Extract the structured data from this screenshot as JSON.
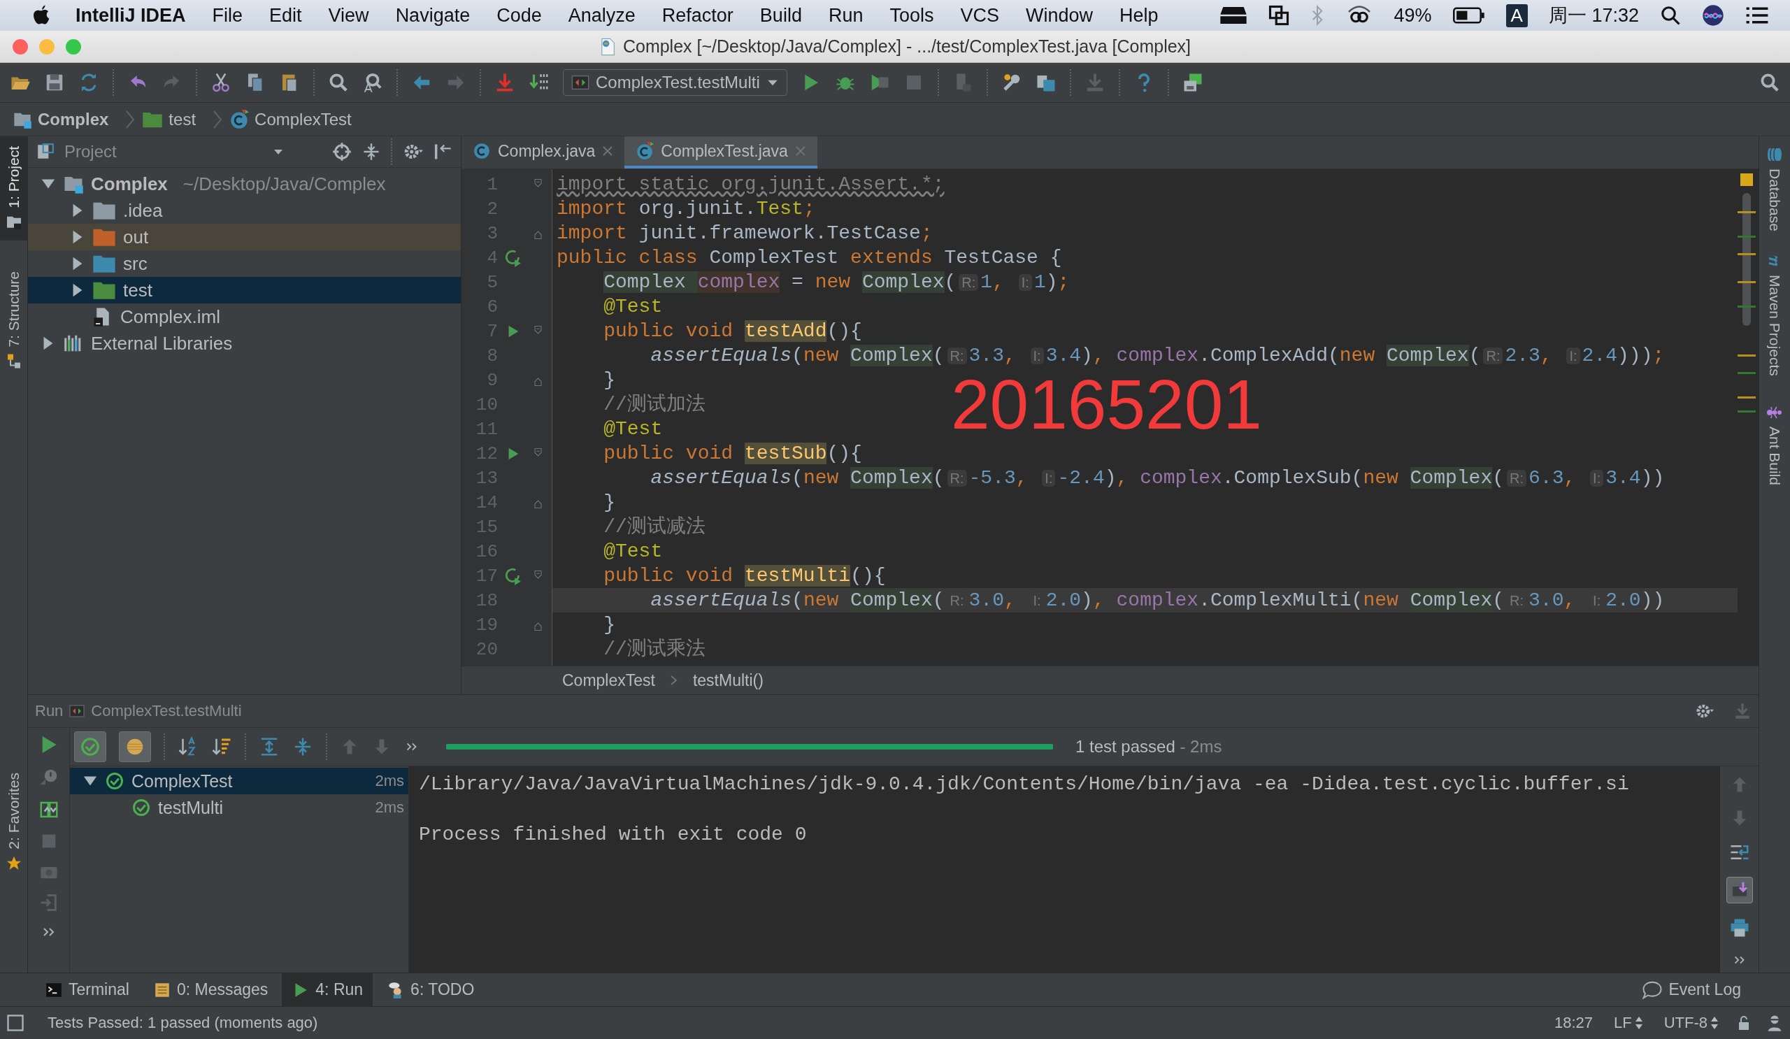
{
  "menubar": {
    "app": "IntelliJ IDEA",
    "items": [
      "File",
      "Edit",
      "View",
      "Navigate",
      "Code",
      "Analyze",
      "Refactor",
      "Build",
      "Run",
      "Tools",
      "VCS",
      "Window",
      "Help"
    ],
    "battery": "49%",
    "input_source": "A",
    "clock": "周一 17:32"
  },
  "window": {
    "title": "Complex [~/Desktop/Java/Complex] - .../test/ComplexTest.java [Complex]"
  },
  "toolbar": {
    "run_config": "ComplexTest.testMulti"
  },
  "navigation": [
    {
      "label": "Complex",
      "kind": "module"
    },
    {
      "label": "test",
      "kind": "folder"
    },
    {
      "label": "ComplexTest",
      "kind": "class"
    }
  ],
  "tool_windows_left": [
    {
      "label": "1: Project",
      "selected": true
    },
    {
      "label": "7: Structure",
      "selected": false
    }
  ],
  "favorites": {
    "label": "2: Favorites",
    "selected": false
  },
  "project": {
    "title": "Project",
    "tree": [
      {
        "name": "Complex",
        "path": "~/Desktop/Java/Complex",
        "kind": "module",
        "expanded": true,
        "selected": false,
        "children": [
          {
            "name": ".idea",
            "kind": "folder",
            "color": "#8e9ba5",
            "expanded": false,
            "selected": false,
            "excluded": false
          },
          {
            "name": "out",
            "kind": "folder",
            "color": "#c0602b",
            "expanded": false,
            "selected": false,
            "excluded": true
          },
          {
            "name": "src",
            "kind": "folder",
            "color": "#3d8aac",
            "expanded": false,
            "selected": false,
            "excluded": false
          },
          {
            "name": "test",
            "kind": "folder",
            "color": "#4b8b3e",
            "expanded": false,
            "selected": true,
            "excluded": false
          },
          {
            "name": "Complex.iml",
            "kind": "file",
            "selected": false
          }
        ]
      },
      {
        "name": "External Libraries",
        "kind": "libraries",
        "expanded": false,
        "selected": false
      }
    ]
  },
  "editor": {
    "tabs": [
      {
        "label": "Complex.java",
        "selected": false
      },
      {
        "label": "ComplexTest.java",
        "selected": true
      }
    ],
    "lines": [
      {
        "number": "1",
        "fold": {
          "kind": "open"
        },
        "tokens": [
          {
            "kind": "unused",
            "text": "import static org.junit.Assert.*;"
          }
        ]
      },
      {
        "number": "2",
        "tokens": [
          {
            "kind": "kw",
            "text": "import "
          },
          {
            "kind": "plain",
            "text": "org.junit."
          },
          {
            "kind": "ann",
            "text": "Test"
          },
          {
            "kind": "kw",
            "text": ";"
          }
        ]
      },
      {
        "number": "3",
        "fold": {
          "kind": "close"
        },
        "tokens": [
          {
            "kind": "kw",
            "text": "import "
          },
          {
            "kind": "plain",
            "text": "junit.framework.TestCase"
          },
          {
            "kind": "kw",
            "text": ";"
          }
        ]
      },
      {
        "number": "4",
        "gutter": {
          "kind": "rerun"
        },
        "tokens": [
          {
            "kind": "kw",
            "text": "public class "
          },
          {
            "kind": "plain",
            "text": "ComplexTest "
          },
          {
            "kind": "kw",
            "text": "extends "
          },
          {
            "kind": "plain",
            "text": "TestCase {"
          }
        ]
      },
      {
        "number": "5",
        "indent": {
          "kind": "member"
        },
        "tokens": [
          {
            "kind": "type",
            "text": "Complex "
          },
          {
            "kind": "fieldhl",
            "text": "complex"
          },
          {
            "kind": "plain",
            "text": " = "
          },
          {
            "kind": "kw",
            "text": "new "
          },
          {
            "kind": "type",
            "text": "Complex"
          },
          {
            "kind": "plain",
            "text": "("
          },
          {
            "kind": "hint",
            "text": "R:"
          },
          {
            "kind": "num",
            "text": "1"
          },
          {
            "kind": "kw",
            "text": ", "
          },
          {
            "kind": "hint",
            "text": "I:"
          },
          {
            "kind": "num",
            "text": "1"
          },
          {
            "kind": "plain",
            "text": ")"
          },
          {
            "kind": "kw",
            "text": ";"
          }
        ]
      },
      {
        "number": "6",
        "indent": {
          "kind": "member"
        },
        "tokens": [
          {
            "kind": "ann",
            "text": "@Test"
          }
        ]
      },
      {
        "number": "7",
        "indent": {
          "kind": "member"
        },
        "gutter": {
          "kind": "run"
        },
        "fold": {
          "kind": "open"
        },
        "tokens": [
          {
            "kind": "kw",
            "text": "public void "
          },
          {
            "kind": "method",
            "text": "testAdd"
          },
          {
            "kind": "plain",
            "text": "(){"
          }
        ]
      },
      {
        "number": "8",
        "indent": {
          "kind": "body"
        },
        "tokens": [
          {
            "kind": "call",
            "text": "assertEquals"
          },
          {
            "kind": "plain",
            "text": "("
          },
          {
            "kind": "kw",
            "text": "new "
          },
          {
            "kind": "type",
            "text": "Complex"
          },
          {
            "kind": "plain",
            "text": "("
          },
          {
            "kind": "hint",
            "text": "R:"
          },
          {
            "kind": "num",
            "text": "3.3"
          },
          {
            "kind": "kw",
            "text": ", "
          },
          {
            "kind": "hint",
            "text": "I:"
          },
          {
            "kind": "num",
            "text": "3.4"
          },
          {
            "kind": "plain",
            "text": ")"
          },
          {
            "kind": "kw",
            "text": ", "
          },
          {
            "kind": "field",
            "text": "complex"
          },
          {
            "kind": "plain",
            "text": ".ComplexAdd("
          },
          {
            "kind": "kw",
            "text": "new "
          },
          {
            "kind": "type",
            "text": "Complex"
          },
          {
            "kind": "plain",
            "text": "("
          },
          {
            "kind": "hint",
            "text": "R:"
          },
          {
            "kind": "num",
            "text": "2.3"
          },
          {
            "kind": "kw",
            "text": ", "
          },
          {
            "kind": "hint",
            "text": "I:"
          },
          {
            "kind": "num",
            "text": "2.4"
          },
          {
            "kind": "plain",
            "text": ")))"
          },
          {
            "kind": "kw",
            "text": ";"
          }
        ]
      },
      {
        "number": "9",
        "indent": {
          "kind": "member"
        },
        "fold": {
          "kind": "close"
        },
        "tokens": [
          {
            "kind": "plain",
            "text": "}"
          }
        ]
      },
      {
        "number": "10",
        "indent": {
          "kind": "member"
        },
        "tokens": [
          {
            "kind": "comment",
            "text": "//测试加法"
          }
        ]
      },
      {
        "number": "11",
        "indent": {
          "kind": "member"
        },
        "tokens": [
          {
            "kind": "ann",
            "text": "@Test"
          }
        ]
      },
      {
        "number": "12",
        "indent": {
          "kind": "member"
        },
        "gutter": {
          "kind": "run"
        },
        "fold": {
          "kind": "open"
        },
        "tokens": [
          {
            "kind": "kw",
            "text": "public void "
          },
          {
            "kind": "method",
            "text": "testSub"
          },
          {
            "kind": "plain",
            "text": "(){"
          }
        ]
      },
      {
        "number": "13",
        "indent": {
          "kind": "body"
        },
        "tokens": [
          {
            "kind": "call",
            "text": "assertEquals"
          },
          {
            "kind": "plain",
            "text": "("
          },
          {
            "kind": "kw",
            "text": "new "
          },
          {
            "kind": "type",
            "text": "Complex"
          },
          {
            "kind": "plain",
            "text": "("
          },
          {
            "kind": "hint",
            "text": "R:"
          },
          {
            "kind": "num",
            "text": "-5.3"
          },
          {
            "kind": "kw",
            "text": ", "
          },
          {
            "kind": "hint",
            "text": "I:"
          },
          {
            "kind": "num",
            "text": "-2.4"
          },
          {
            "kind": "plain",
            "text": ")"
          },
          {
            "kind": "kw",
            "text": ", "
          },
          {
            "kind": "field",
            "text": "complex"
          },
          {
            "kind": "plain",
            "text": ".ComplexSub("
          },
          {
            "kind": "kw",
            "text": "new "
          },
          {
            "kind": "type",
            "text": "Complex"
          },
          {
            "kind": "plain",
            "text": "("
          },
          {
            "kind": "hint",
            "text": "R:"
          },
          {
            "kind": "num",
            "text": "6.3"
          },
          {
            "kind": "kw",
            "text": ", "
          },
          {
            "kind": "hint",
            "text": "I:"
          },
          {
            "kind": "num",
            "text": "3.4"
          },
          {
            "kind": "plain",
            "text": "))"
          }
        ]
      },
      {
        "number": "14",
        "indent": {
          "kind": "member"
        },
        "fold": {
          "kind": "close"
        },
        "tokens": [
          {
            "kind": "plain",
            "text": "}"
          }
        ]
      },
      {
        "number": "15",
        "indent": {
          "kind": "member"
        },
        "tokens": [
          {
            "kind": "comment",
            "text": "//测试减法"
          }
        ]
      },
      {
        "number": "16",
        "indent": {
          "kind": "member"
        },
        "tokens": [
          {
            "kind": "ann",
            "text": "@Test"
          }
        ]
      },
      {
        "number": "17",
        "indent": {
          "kind": "member"
        },
        "gutter": {
          "kind": "rerun"
        },
        "fold": {
          "kind": "open"
        },
        "tokens": [
          {
            "kind": "kw",
            "text": "public void "
          },
          {
            "kind": "method",
            "text": "testMulti"
          },
          {
            "kind": "plain",
            "text": "(){"
          }
        ]
      },
      {
        "number": "18",
        "indent": {
          "kind": "body"
        },
        "current": true,
        "tokens": [
          {
            "kind": "call",
            "text": "assertEquals"
          },
          {
            "kind": "plain",
            "text": "("
          },
          {
            "kind": "kw",
            "text": "new "
          },
          {
            "kind": "type",
            "text": "Complex"
          },
          {
            "kind": "plain",
            "text": "("
          },
          {
            "kind": "hint",
            "text": "R:"
          },
          {
            "kind": "num",
            "text": "3.0"
          },
          {
            "kind": "kw",
            "text": ", "
          },
          {
            "kind": "hint",
            "text": "I:"
          },
          {
            "kind": "num",
            "text": "2.0"
          },
          {
            "kind": "plain",
            "text": ")"
          },
          {
            "kind": "kw",
            "text": ", "
          },
          {
            "kind": "field",
            "text": "complex"
          },
          {
            "kind": "plain",
            "text": ".ComplexMulti("
          },
          {
            "kind": "kw",
            "text": "new "
          },
          {
            "kind": "type",
            "text": "Complex"
          },
          {
            "kind": "plain",
            "text": "("
          },
          {
            "kind": "hint",
            "text": "R:"
          },
          {
            "kind": "num",
            "text": "3.0"
          },
          {
            "kind": "kw",
            "text": ", "
          },
          {
            "kind": "hint",
            "text": "I:"
          },
          {
            "kind": "num",
            "text": "2.0"
          },
          {
            "kind": "plain",
            "text": "))"
          }
        ]
      },
      {
        "number": "19",
        "indent": {
          "kind": "member"
        },
        "fold": {
          "kind": "close"
        },
        "tokens": [
          {
            "kind": "plain",
            "text": "}"
          }
        ]
      },
      {
        "number": "20",
        "indent": {
          "kind": "member"
        },
        "tokens": [
          {
            "kind": "comment",
            "text": "//测试乘法"
          }
        ]
      }
    ],
    "breadcrumbs": [
      "ComplexTest",
      "testMulti()"
    ]
  },
  "overlay_text": "20165201",
  "tool_windows_right": [
    {
      "label": "Database",
      "kind": "database"
    },
    {
      "label": "Maven Projects",
      "kind": "maven"
    },
    {
      "label": "Ant Build",
      "kind": "ant"
    }
  ],
  "run": {
    "title": "Run",
    "config": "ComplexTest.testMulti",
    "filters": [
      {
        "kind": "passed",
        "on": true
      },
      {
        "kind": "ignored",
        "on": true
      }
    ],
    "progress": {
      "level": 1,
      "summary": "1 test passed",
      "duration": "- 2ms"
    },
    "tree": [
      {
        "name": "ComplexTest",
        "time": "2ms",
        "expanded": true,
        "selected": true,
        "children": [
          {
            "name": "testMulti",
            "time": "2ms",
            "selected": false
          }
        ]
      }
    ],
    "console": [
      "/Library/Java/JavaVirtualMachines/jdk-9.0.4.jdk/Contents/Home/bin/java -ea -Didea.test.cyclic.buffer.si",
      "Process finished with exit code 0"
    ]
  },
  "bottom_tabs": [
    {
      "label": "Terminal",
      "kind": "terminal",
      "selected": false
    },
    {
      "label": "0: Messages",
      "kind": "messages",
      "selected": false
    },
    {
      "label": "4: Run",
      "kind": "run",
      "selected": true
    },
    {
      "label": "6: TODO",
      "kind": "todo",
      "selected": false
    }
  ],
  "event_log": "Event Log",
  "status_bar": {
    "message": "Tests Passed: 1 passed (moments ago)",
    "position": "18:27",
    "line_separator": "LF",
    "encoding": "UTF-8"
  }
}
